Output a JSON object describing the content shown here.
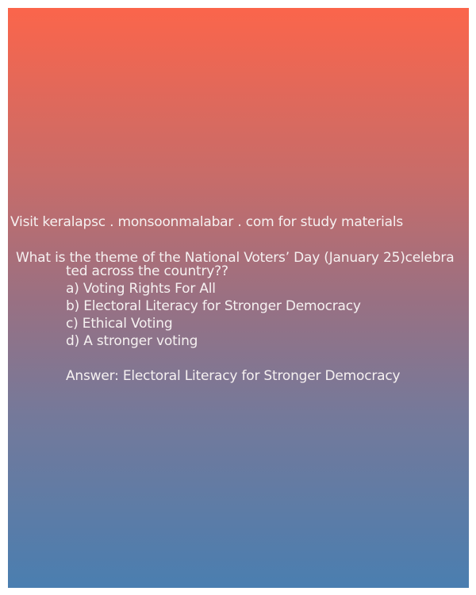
{
  "header": {
    "site_text": "Visit keralapsc . monsoonmalabar . com for study materials"
  },
  "question": {
    "line1": "What is the theme of the National Voters’ Day (January 25)celebra",
    "line2": "ted across the country??"
  },
  "options": {
    "a": "a) Voting Rights For All",
    "b": "b) Electoral Literacy for Stronger Democracy",
    "c": "c) Ethical Voting",
    "d": "d) A stronger voting"
  },
  "answer": {
    "text": "Answer: Electoral Literacy for Stronger Democracy"
  },
  "colors": {
    "gradient_top": "#fb654b",
    "gradient_bottom": "#4a7eb0",
    "text": "#f6f1f1"
  }
}
